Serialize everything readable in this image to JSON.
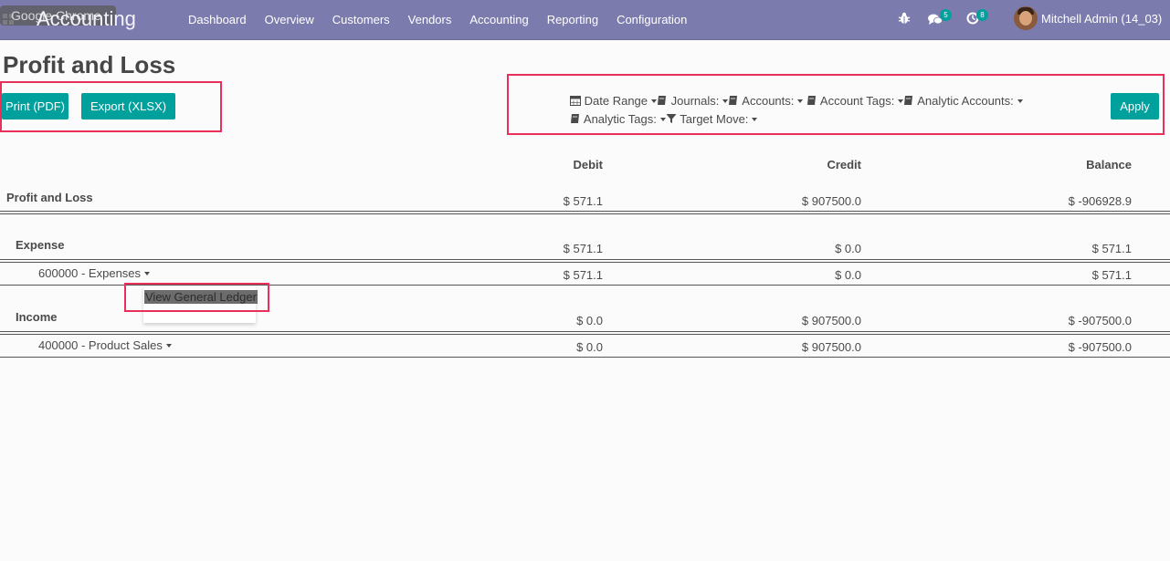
{
  "navbar": {
    "app_title": "Accounting",
    "chrome_tooltip": "Google Chrome",
    "menu": [
      "Dashboard",
      "Overview",
      "Customers",
      "Vendors",
      "Accounting",
      "Reporting",
      "Configuration"
    ],
    "messages_count": "5",
    "activities_count": "8",
    "user_name": "Mitchell Admin (14_03)",
    "color": "#7c7bad"
  },
  "page": {
    "title": "Profit and Loss",
    "print_label": "Print (PDF)",
    "export_label": "Export (XLSX)",
    "apply_label": "Apply",
    "accent_color": "#00a09d",
    "highlight_color": "#e8305a"
  },
  "filters": {
    "date_range": "Date Range",
    "journals": "Journals:",
    "accounts": "Accounts:",
    "account_tags": "Account Tags:",
    "analytic_accounts": "Analytic Accounts:",
    "analytic_tags": "Analytic Tags:",
    "target_move": "Target Move:"
  },
  "table": {
    "headers": {
      "debit": "Debit",
      "credit": "Credit",
      "balance": "Balance"
    },
    "rows": [
      {
        "label": "Profit and Loss",
        "debit": "$ 571.1",
        "credit": "$ 907500.0",
        "balance": "$ -906928.9"
      },
      {
        "label": "Expense",
        "debit": "$ 571.1",
        "credit": "$ 0.0",
        "balance": "$ 571.1"
      },
      {
        "label": "600000 - Expenses",
        "debit": "$ 571.1",
        "credit": "$ 0.0",
        "balance": "$ 571.1"
      },
      {
        "label": "Income",
        "debit": "$ 0.0",
        "credit": "$ 907500.0",
        "balance": "$ -907500.0"
      },
      {
        "label": "400000 - Product Sales",
        "debit": "$ 0.0",
        "credit": "$ 907500.0",
        "balance": "$ -907500.0"
      }
    ]
  },
  "dropdown": {
    "view_general_ledger": "View General Ledger"
  }
}
